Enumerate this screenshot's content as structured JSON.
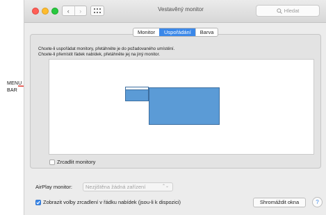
{
  "annotation": {
    "label_line1": "MENU",
    "label_line2": "BAR",
    "arrow_color": "#e0332a"
  },
  "window": {
    "title": "Vestavěný monitor",
    "nav_back": "‹",
    "nav_forward": "›",
    "search_placeholder": "Hledat"
  },
  "tabs": [
    {
      "label": "Monitor",
      "active": false
    },
    {
      "label": "Uspořádání",
      "active": true
    },
    {
      "label": "Barva",
      "active": false
    }
  ],
  "instructions": {
    "line1": "Chcete-li uspořádat monitory, přetáhněte je do požadovaného umístění.",
    "line2": "Chcete-li přemístit řádek nabídek, přetáhněte jej na jiný monitor."
  },
  "mirror": {
    "label": "Zrcadlit monitory",
    "checked": false
  },
  "airplay": {
    "label": "AirPlay monitor:",
    "value": "Nezjištěna žádná zařízení"
  },
  "show_mirroring": {
    "label": "Zobrazit volby zrcadlení v řádku nabídek (jsou-li k dispozici)",
    "checked": true
  },
  "buttons": {
    "gather_windows": "Shromáždit okna",
    "help": "?"
  },
  "colors": {
    "accent": "#3b88e9",
    "monitor_fill": "#5b9bd6"
  }
}
